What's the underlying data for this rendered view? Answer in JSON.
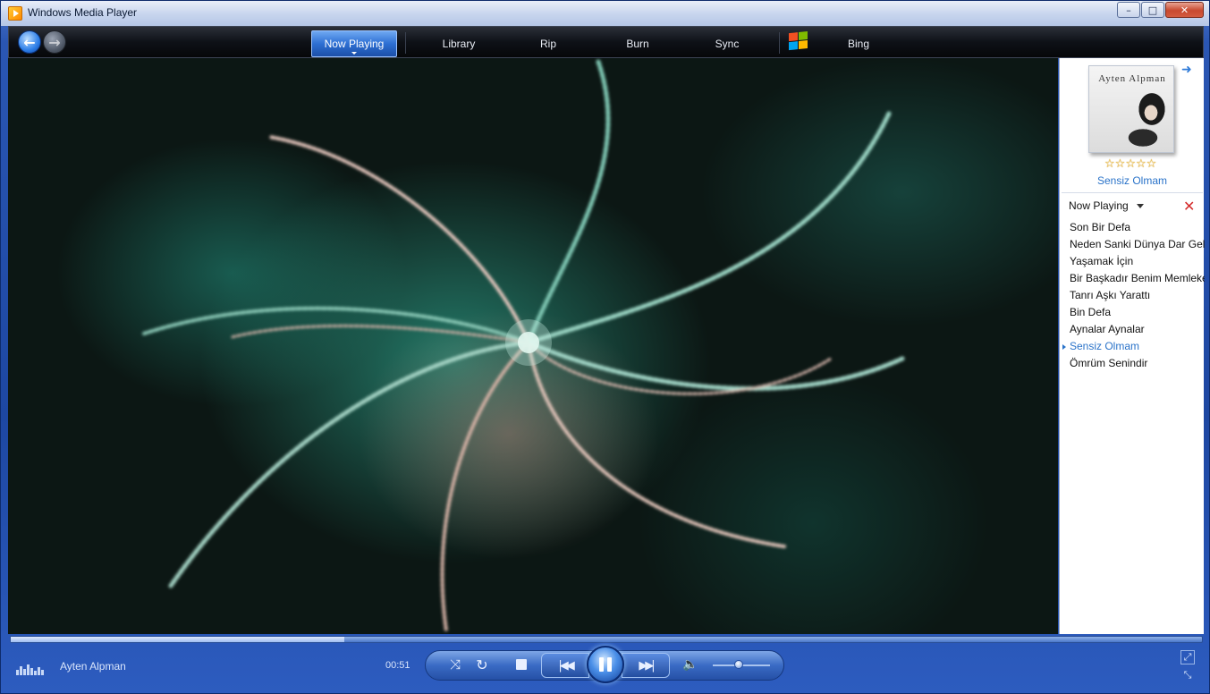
{
  "window": {
    "title": "Windows Media Player",
    "controls": {
      "minimize": "–",
      "maximize": "□",
      "close": "✕"
    }
  },
  "toolbar": {
    "back_icon": "back-arrow-icon",
    "forward_icon": "forward-arrow-icon",
    "tabs": [
      {
        "label": "Now Playing",
        "active": true
      },
      {
        "label": "Library",
        "active": false
      },
      {
        "label": "Rip",
        "active": false
      },
      {
        "label": "Burn",
        "active": false
      },
      {
        "label": "Sync",
        "active": false
      },
      {
        "label": "Bing",
        "active": false
      }
    ]
  },
  "pane": {
    "album_art_text": "Ayten Alpman",
    "rating": 0,
    "rating_max": 5,
    "current_song": "Sensiz Olmam",
    "list_header": "Now Playing",
    "playlist": [
      {
        "title": "Son Bir Defa",
        "current": false
      },
      {
        "title": "Neden Sanki Dünya Dar Gelir",
        "current": false
      },
      {
        "title": "Yaşamak İçin",
        "current": false
      },
      {
        "title": "Bir Başkadır Benim Memleketim",
        "current": false
      },
      {
        "title": "Tanrı Aşkı Yarattı",
        "current": false
      },
      {
        "title": "Bin Defa",
        "current": false
      },
      {
        "title": "Aynalar Aynalar",
        "current": false
      },
      {
        "title": "Sensiz Olmam",
        "current": true
      },
      {
        "title": "Ömrüm Senindir",
        "current": false
      }
    ]
  },
  "playback": {
    "artist": "Ayten Alpman",
    "elapsed": "00:51",
    "seek_fraction": 0.28,
    "volume_fraction": 0.45,
    "state": "playing"
  },
  "colors": {
    "accent": "#2a73c9",
    "visualization_base": "#0c1714",
    "visualization_teal": "#2a8c78"
  }
}
